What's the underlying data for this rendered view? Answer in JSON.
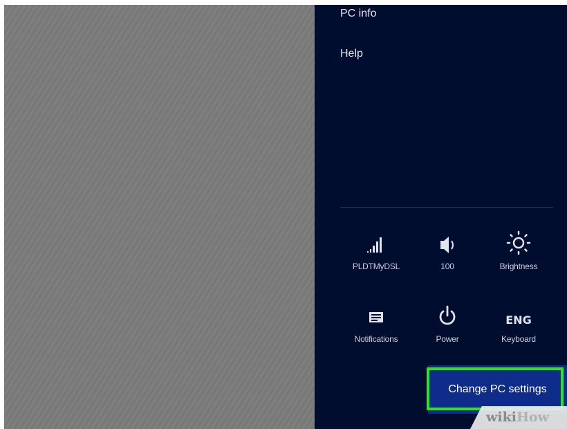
{
  "charm_menu": {
    "items": [
      {
        "label": "PC info"
      },
      {
        "label": "Help"
      }
    ]
  },
  "quick_settings": {
    "row1": [
      {
        "icon": "signal-bars-icon",
        "label": "PLDTMyDSL"
      },
      {
        "icon": "speaker-volume-icon",
        "label": "100"
      },
      {
        "icon": "brightness-sun-icon",
        "label": "Brightness"
      }
    ],
    "row2": [
      {
        "icon": "notifications-icon",
        "label": "Notifications"
      },
      {
        "icon": "power-icon",
        "label": "Power"
      },
      {
        "icon_text": "ENG",
        "label": "Keyboard"
      }
    ]
  },
  "change_pc_settings": {
    "label": "Change PC settings"
  },
  "watermark": {
    "wiki": "wiki",
    "how": "How"
  },
  "colors": {
    "charm_bg": "#000d2e",
    "button_bg": "#0e2d8a",
    "highlight": "#2ee51d",
    "desktop": "#7b7b7b"
  }
}
